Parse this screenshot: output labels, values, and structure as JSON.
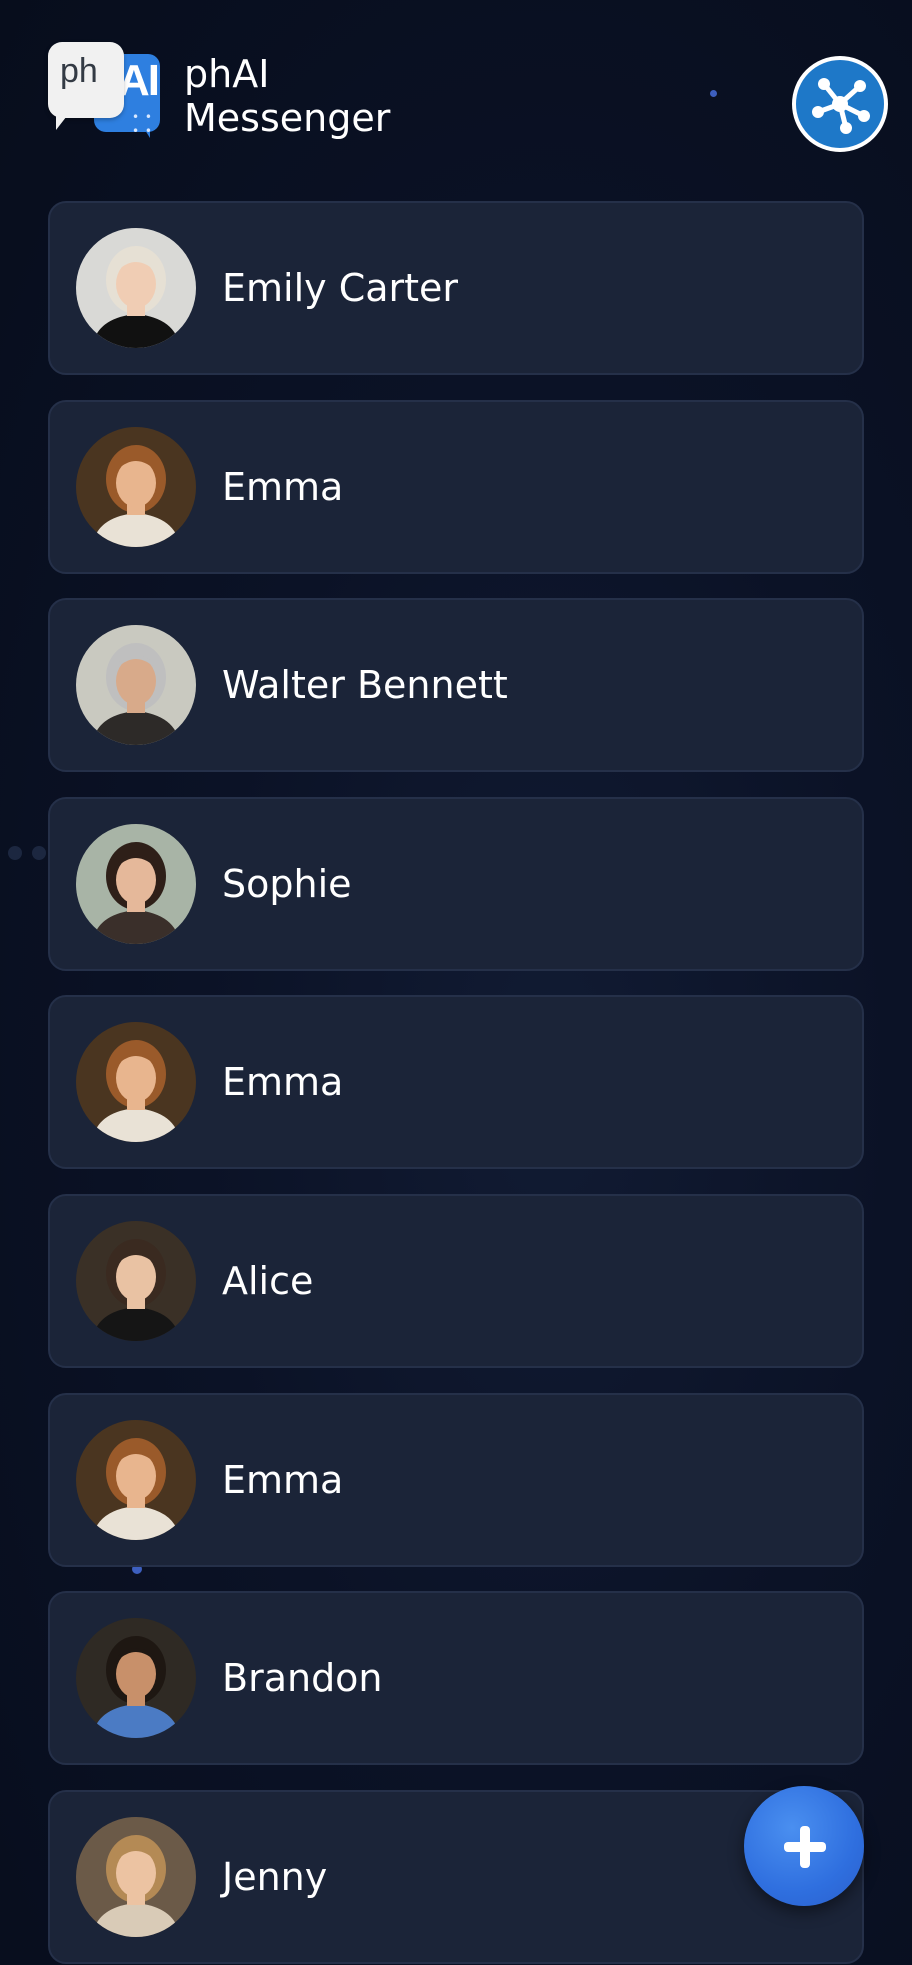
{
  "app": {
    "title_line1": "phAI",
    "title_line2": "Messenger",
    "logo_left_text": "ph",
    "logo_right_text": "AI",
    "logo_dots": "• • • •"
  },
  "colors": {
    "background": "#0b1226",
    "card": "#1b2438",
    "accent_blue": "#2f6fdf",
    "network_button": "#1e78c8"
  },
  "header": {
    "network_button_icon": "network-nodes-icon"
  },
  "contacts": [
    {
      "name": "Emily Carter",
      "avatar": {
        "bg": "#d9d9d6",
        "skin": "#f0cdb4",
        "hair": "#e6e0d4",
        "shirt": "#111111"
      }
    },
    {
      "name": "Emma",
      "avatar": {
        "bg": "#4a3520",
        "skin": "#e8b58e",
        "hair": "#9a5a2a",
        "shirt": "#e9e2d6"
      }
    },
    {
      "name": "Walter Bennett",
      "avatar": {
        "bg": "#c9c9c0",
        "skin": "#d8aa8a",
        "hair": "#bfbfbf",
        "shirt": "#2d2a28"
      }
    },
    {
      "name": "Sophie",
      "avatar": {
        "bg": "#a8b4a6",
        "skin": "#e5b89a",
        "hair": "#2e1f18",
        "shirt": "#3a2f2a"
      }
    },
    {
      "name": "Emma",
      "avatar": {
        "bg": "#4a3520",
        "skin": "#e8b58e",
        "hair": "#9a5a2a",
        "shirt": "#e9e2d6"
      }
    },
    {
      "name": "Alice",
      "avatar": {
        "bg": "#3a3026",
        "skin": "#e9c2a3",
        "hair": "#3a2a20",
        "shirt": "#151515"
      }
    },
    {
      "name": "Emma",
      "avatar": {
        "bg": "#4a3520",
        "skin": "#e8b58e",
        "hair": "#9a5a2a",
        "shirt": "#e9e2d6"
      }
    },
    {
      "name": "Brandon",
      "avatar": {
        "bg": "#2f2a24",
        "skin": "#c8906a",
        "hair": "#1e1712",
        "shirt": "#4b7bc4"
      }
    },
    {
      "name": "Jenny",
      "avatar": {
        "bg": "#6b5a48",
        "skin": "#ecc3a2",
        "hair": "#b48a55",
        "shirt": "#d9cbb7"
      }
    }
  ],
  "fab": {
    "icon": "plus-icon"
  }
}
